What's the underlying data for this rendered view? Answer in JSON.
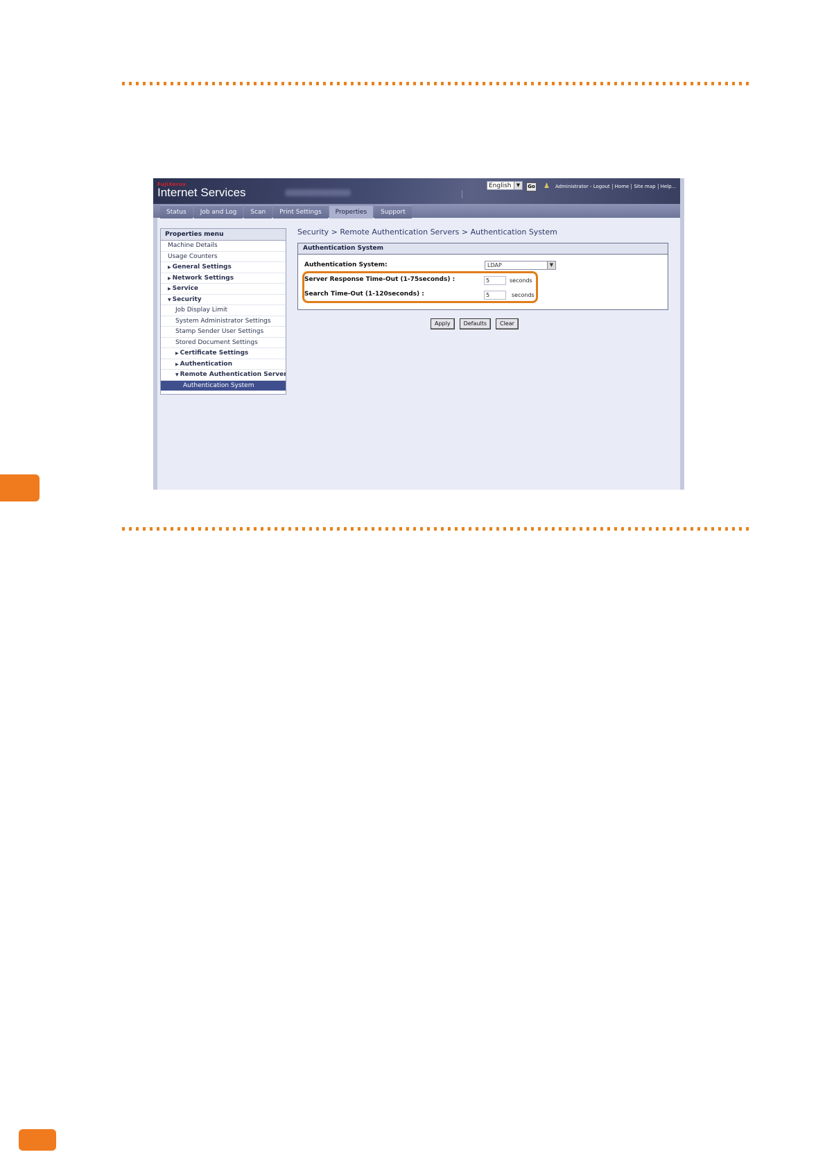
{
  "header": {
    "brand_small": "FujiXerox",
    "brand": "Internet Services",
    "language": "English",
    "go_label": "Go",
    "links": [
      "Administrator - Logout",
      "Home",
      "Site map",
      "Help..."
    ]
  },
  "tabs": [
    "Status",
    "Job and Log",
    "Scan",
    "Print Settings",
    "Properties",
    "Support"
  ],
  "active_tab": "Properties",
  "menu": {
    "title": "Properties menu",
    "items": [
      {
        "label": "Machine Details"
      },
      {
        "label": "Usage Counters"
      },
      {
        "label": "General Settings"
      },
      {
        "label": "Network Settings"
      },
      {
        "label": "Service"
      },
      {
        "label": "Security"
      },
      {
        "label": "Job Display Limit"
      },
      {
        "label": "System Administrator Settings"
      },
      {
        "label": "Stamp Sender User Settings"
      },
      {
        "label": "Stored Document Settings"
      },
      {
        "label": "Certificate Settings"
      },
      {
        "label": "Authentication"
      },
      {
        "label": "Remote Authentication Servers"
      },
      {
        "label": "Authentication System"
      }
    ]
  },
  "breadcrumb": "Security > Remote Authentication Servers > Authentication System",
  "panel": {
    "title": "Authentication System",
    "auth_system_label": "Authentication System:",
    "auth_system_value": "LDAP",
    "server_timeout_label": "Server Response Time-Out (1-75seconds) :",
    "server_timeout_value": "5",
    "server_timeout_unit": "seconds",
    "search_timeout_label": "Search Time-Out (1-120seconds) :",
    "search_timeout_value": "5",
    "search_timeout_unit": "seconds"
  },
  "buttons": {
    "apply": "Apply",
    "defaults": "Defaults",
    "clear": "Clear"
  },
  "colors": {
    "accent": "#f07a1e",
    "header": "#2b3150",
    "selected": "#3f4f8e"
  }
}
